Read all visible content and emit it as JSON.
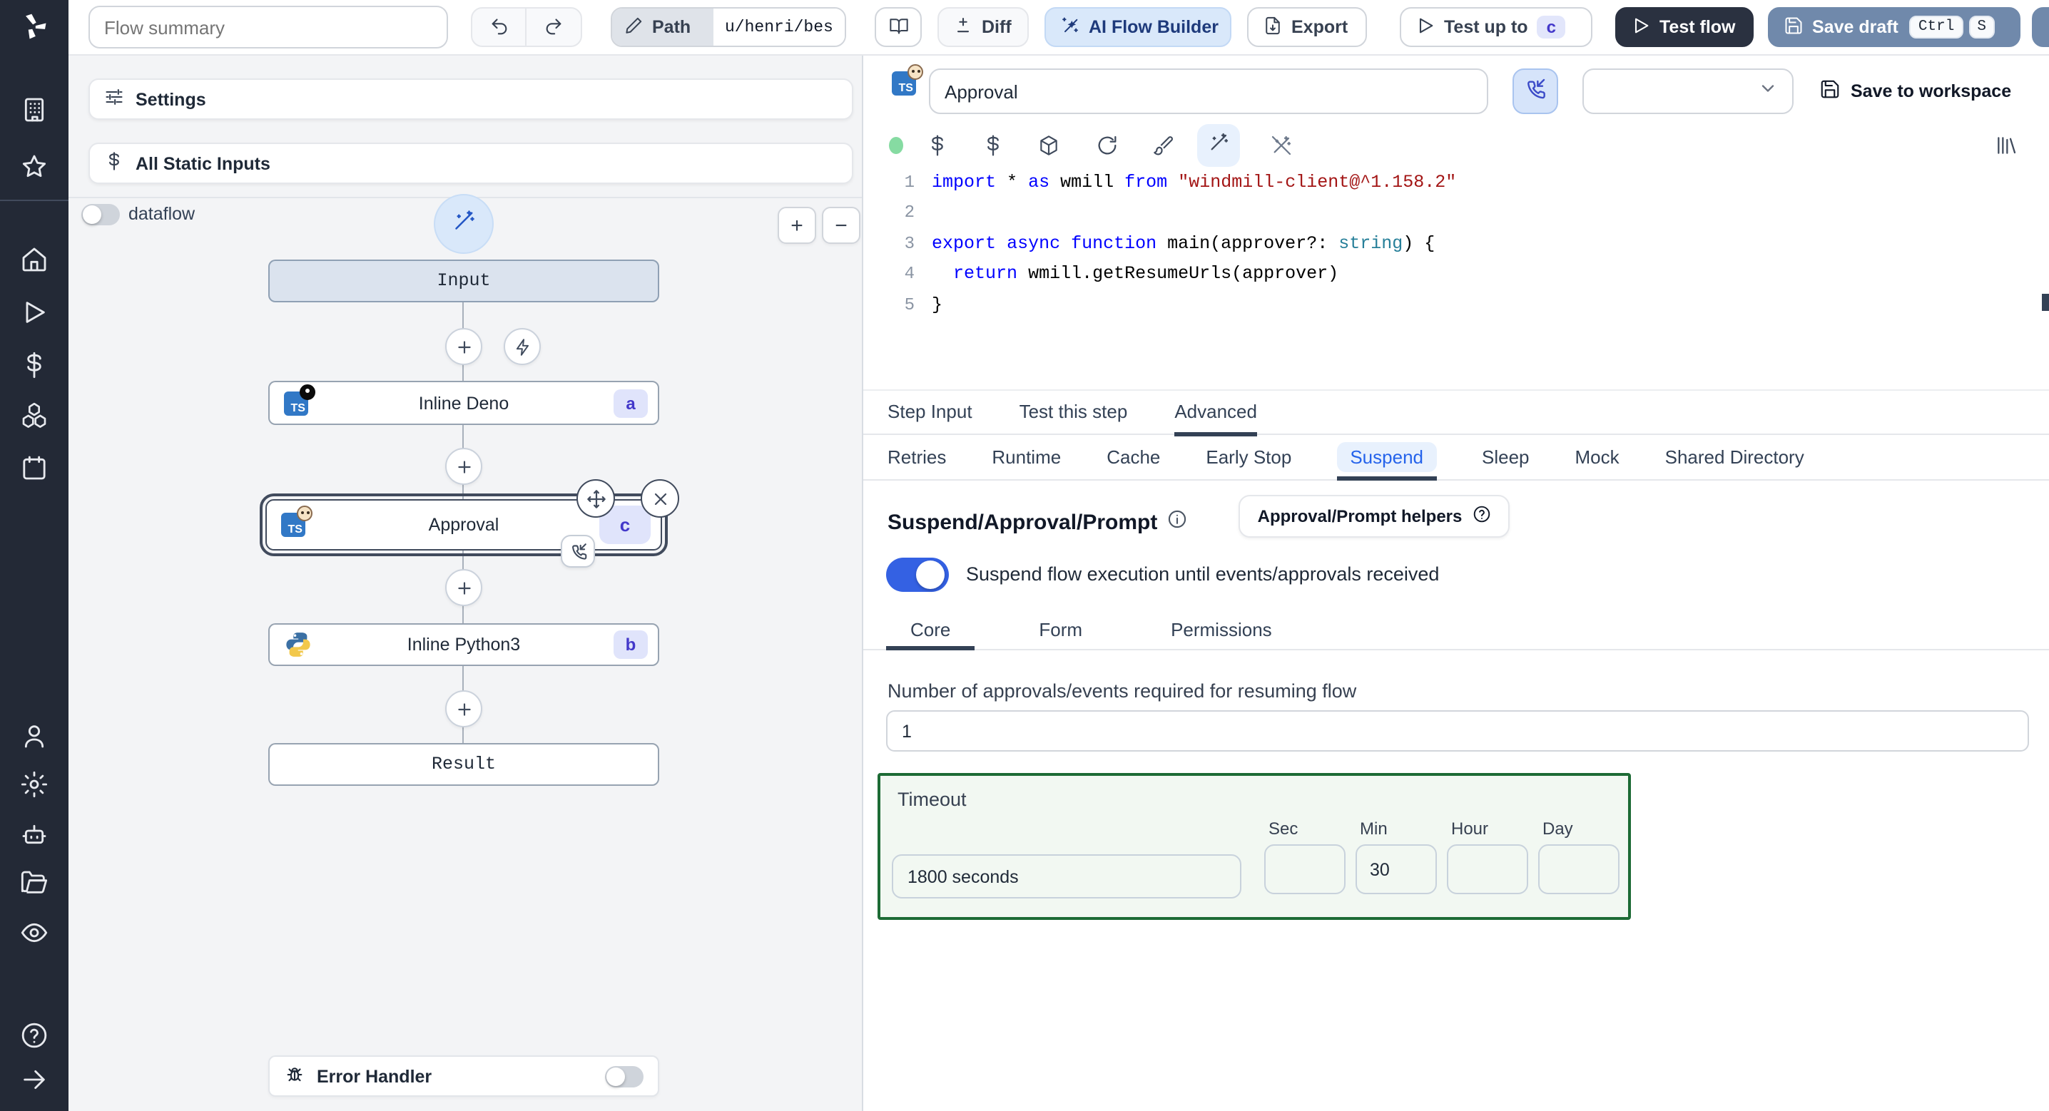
{
  "topbar": {
    "flow_summary_placeholder": "Flow summary",
    "path_label": "Path",
    "path_value": "u/henri/bes",
    "diff_label": "Diff",
    "ai_flow_builder_label": "AI Flow Builder",
    "export_label": "Export",
    "test_up_to_label": "Test up to",
    "test_up_to_badge": "c",
    "test_flow_label": "Test flow",
    "save_draft_label": "Save draft",
    "save_draft_keys": [
      "Ctrl",
      "S"
    ],
    "icons": [
      "undo-icon",
      "redo-icon",
      "pencil-icon",
      "book-open-icon",
      "diff-icon",
      "sparkles-icon",
      "export-icon",
      "play-icon",
      "save-icon"
    ]
  },
  "sidebar": {
    "icons": [
      "windmill-logo",
      "building-icon",
      "star-icon",
      "home-icon",
      "play-icon",
      "dollar-icon",
      "boxes-icon",
      "calendar-icon",
      "user-icon",
      "gear-icon",
      "robot-icon",
      "folder-icon",
      "eye-icon",
      "help-icon",
      "arrow-right-icon"
    ]
  },
  "flow_panel": {
    "settings_label": "Settings",
    "static_inputs_label": "All Static Inputs",
    "dataflow_label": "dataflow",
    "zoom_in": "+",
    "zoom_out": "−",
    "input_node": "Input",
    "steps": [
      {
        "label": "Inline Deno",
        "badge": "a",
        "lang": "deno"
      },
      {
        "label": "Approval",
        "badge": "c",
        "lang": "approval",
        "selected": true
      },
      {
        "label": "Inline Python3",
        "badge": "b",
        "lang": "python"
      }
    ],
    "result_node": "Result",
    "error_handler_label": "Error Handler"
  },
  "step_panel": {
    "step_name_value": "Approval",
    "save_to_workspace_label": "Save to workspace",
    "toolbar_icons": [
      "status-dot",
      "dollar-icon",
      "dollar-icon-2",
      "package-icon",
      "rotate-icon",
      "brush-icon",
      "wand-icon",
      "wand-off-icon",
      "library-icon"
    ],
    "code": {
      "lines": [
        {
          "n": "1",
          "tokens": [
            {
              "t": "import",
              "k": "kw"
            },
            {
              "t": " * ",
              "k": "pl"
            },
            {
              "t": "as",
              "k": "kw"
            },
            {
              "t": " wmill ",
              "k": "pl"
            },
            {
              "t": "from",
              "k": "kw"
            },
            {
              "t": " ",
              "k": "pl"
            },
            {
              "t": "\"windmill-client@^1.158.2\"",
              "k": "str"
            }
          ]
        },
        {
          "n": "2",
          "tokens": []
        },
        {
          "n": "3",
          "tokens": [
            {
              "t": "export",
              "k": "kw"
            },
            {
              "t": " ",
              "k": "pl"
            },
            {
              "t": "async",
              "k": "kw"
            },
            {
              "t": " ",
              "k": "pl"
            },
            {
              "t": "function",
              "k": "kw"
            },
            {
              "t": " main(approver?: ",
              "k": "pl"
            },
            {
              "t": "string",
              "k": "ty"
            },
            {
              "t": ") {",
              "k": "pl"
            }
          ]
        },
        {
          "n": "4",
          "tokens": [
            {
              "t": "  ",
              "k": "pl"
            },
            {
              "t": "return",
              "k": "kw"
            },
            {
              "t": " wmill.getResumeUrls(approver)",
              "k": "pl"
            }
          ]
        },
        {
          "n": "5",
          "tokens": [
            {
              "t": "}",
              "k": "pl"
            }
          ]
        }
      ]
    },
    "tabs": [
      {
        "label": "Step Input",
        "name": "tab-step-input",
        "active": false
      },
      {
        "label": "Test this step",
        "name": "tab-test-this-step",
        "active": false
      },
      {
        "label": "Advanced",
        "name": "tab-advanced",
        "active": true
      }
    ],
    "subtabs": [
      {
        "label": "Retries",
        "name": "subtab-retries",
        "active": false
      },
      {
        "label": "Runtime",
        "name": "subtab-runtime",
        "active": false
      },
      {
        "label": "Cache",
        "name": "subtab-cache",
        "active": false
      },
      {
        "label": "Early Stop",
        "name": "subtab-early-stop",
        "active": false
      },
      {
        "label": "Suspend",
        "name": "subtab-suspend",
        "active": true
      },
      {
        "label": "Sleep",
        "name": "subtab-sleep",
        "active": false
      },
      {
        "label": "Mock",
        "name": "subtab-mock",
        "active": false
      },
      {
        "label": "Shared Directory",
        "name": "subtab-shared-directory",
        "active": false
      }
    ],
    "suspend": {
      "heading": "Suspend/Approval/Prompt",
      "helpers_button_label": "Approval/Prompt helpers",
      "toggle_label": "Suspend flow execution until events/approvals received",
      "toggle_on": true,
      "core_tabs": [
        {
          "label": "Core",
          "name": "coretab-core",
          "active": true
        },
        {
          "label": "Form",
          "name": "coretab-form",
          "active": false
        },
        {
          "label": "Permissions",
          "name": "coretab-permissions",
          "active": false
        }
      ],
      "approvals_label": "Number of approvals/events required for resuming flow",
      "approvals_value": "1",
      "timeout": {
        "label": "Timeout",
        "display_value": "1800 seconds",
        "units": [
          {
            "label": "Sec",
            "value": ""
          },
          {
            "label": "Min",
            "value": "30"
          },
          {
            "label": "Hour",
            "value": ""
          },
          {
            "label": "Day",
            "value": ""
          }
        ]
      }
    }
  },
  "colors": {
    "sidebar_bg": "#232936",
    "accent_blue": "#3461e3",
    "save_draft_bg": "#7089ab",
    "test_flow_bg": "#2a3140",
    "badge_bg": "#e0e4fb",
    "badge_text": "#4338ca",
    "timeout_border": "#1d6b35",
    "timeout_bg": "#f2f8f2",
    "status_dot": "#86dba2",
    "code_keyword": "#0000ff",
    "code_string": "#a31515",
    "code_type": "#267f99"
  }
}
